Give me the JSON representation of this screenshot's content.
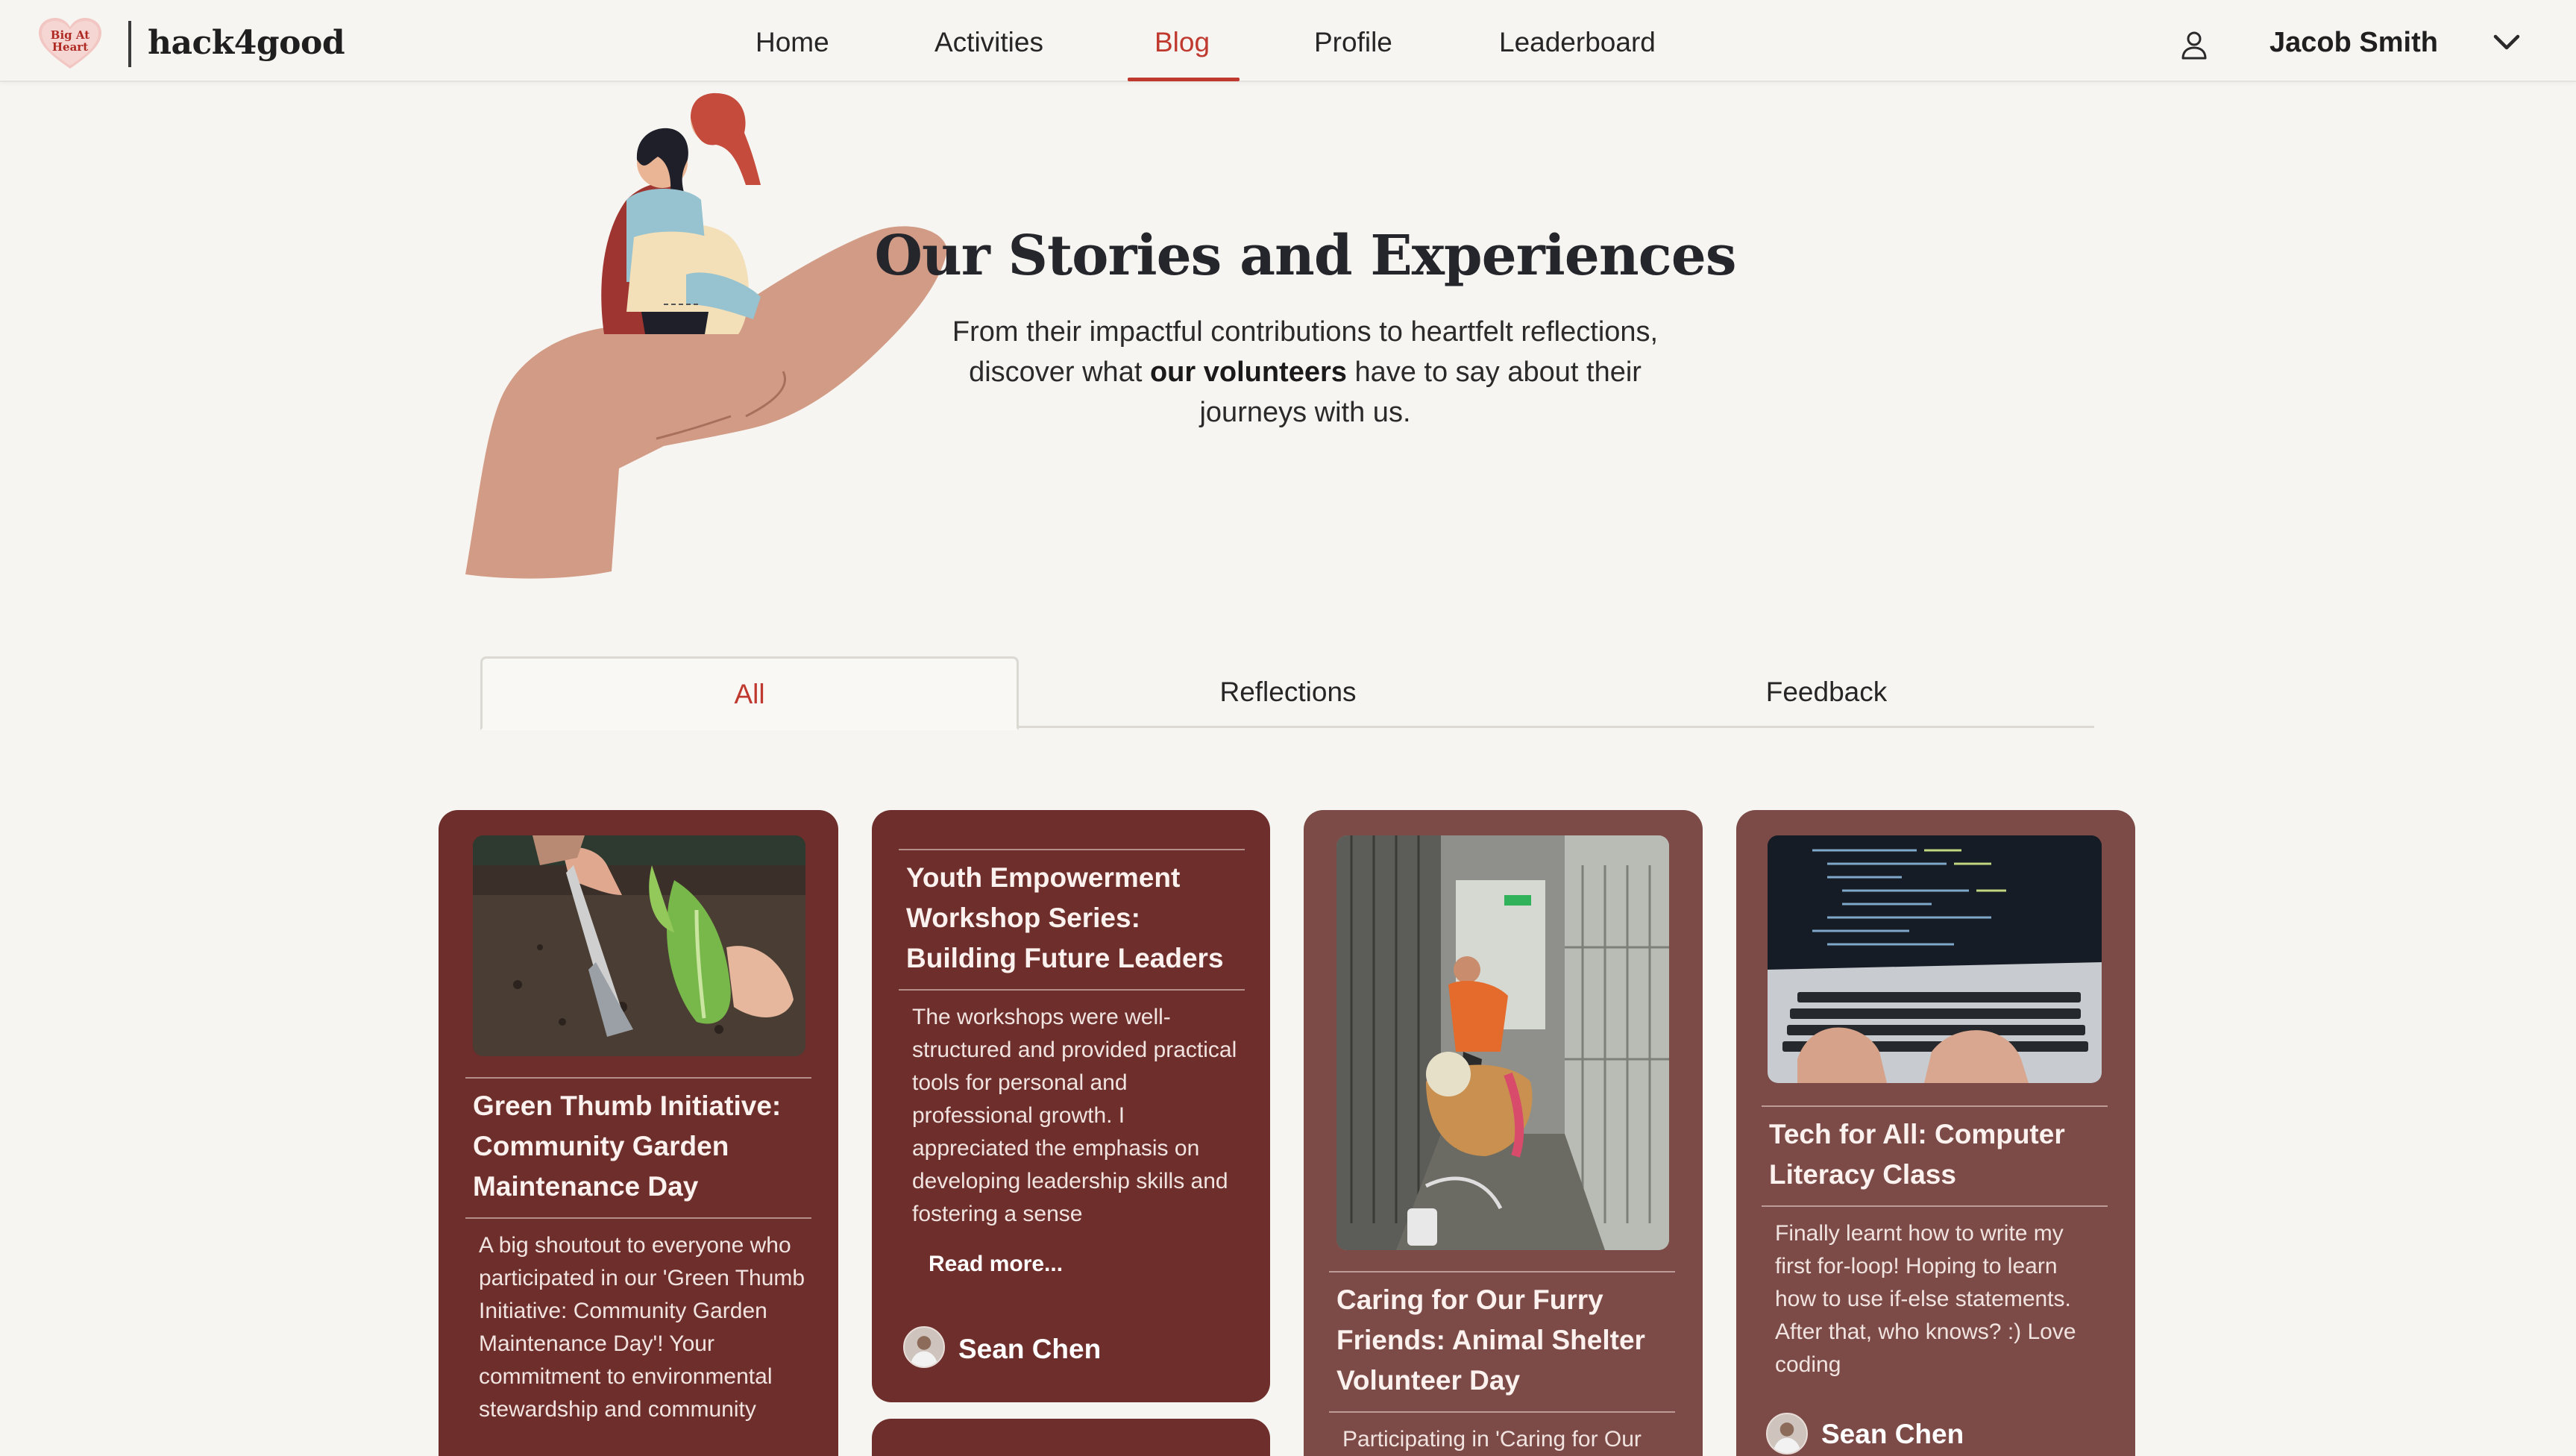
{
  "brand": {
    "logo_text_line1": "Big At",
    "logo_text_line2": "Heart",
    "name": "hack4good"
  },
  "nav": {
    "items": [
      {
        "label": "Home",
        "active": false
      },
      {
        "label": "Activities",
        "active": false
      },
      {
        "label": "Blog",
        "active": true
      },
      {
        "label": "Profile",
        "active": false
      },
      {
        "label": "Leaderboard",
        "active": false
      }
    ],
    "user_name": "Jacob Smith",
    "accent_color": "#c0392f"
  },
  "hero": {
    "title": "Our Stories and Experiences",
    "subtitle_part1": "From their impactful contributions to heartfelt reflections, discover what ",
    "subtitle_bold": "our volunteers",
    "subtitle_part2": " have to say about their journeys with us."
  },
  "tabs": [
    {
      "label": "All",
      "active": true
    },
    {
      "label": "Reflections",
      "active": false
    },
    {
      "label": "Feedback",
      "active": false
    }
  ],
  "cards": [
    {
      "title": "Green Thumb Initiative: Community Garden Maintenance Day",
      "body": "A big shoutout to everyone who participated in our 'Green Thumb Initiative: Community Garden Maintenance Day'! Your commitment to environmental stewardship and community",
      "photo": "gardening-photo"
    },
    {
      "title": "Youth Empowerment Workshop Series: Building Future Leaders",
      "body": "The workshops were well-structured and provided practical tools for personal and professional growth. I appreciated the emphasis on developing leadership skills and fostering a sense",
      "read_more": "Read more...",
      "author": "Sean Chen"
    },
    {
      "title": "Caring for Our Furry Friends: Animal Shelter Volunteer Day",
      "body": "Participating in 'Caring for Our",
      "photo": "animal-shelter-photo"
    },
    {
      "title": "Tech for All: Computer Literacy Class",
      "body": "Finally learnt how to write my first for-loop! Hoping to learn how to use if-else statements. After that, who knows? :) Love coding",
      "author": "Sean Chen",
      "photo": "laptop-coding-photo"
    }
  ],
  "colors": {
    "page_bg": "#f7f5f1",
    "card_dark": "#6e2f2c",
    "card_light": "#7c4b47"
  }
}
